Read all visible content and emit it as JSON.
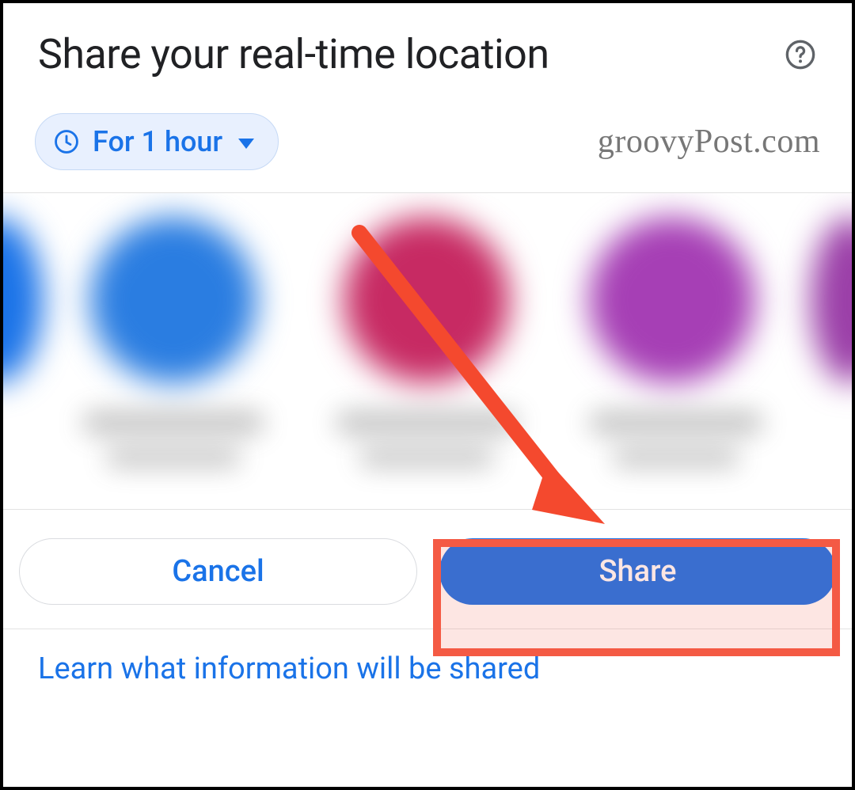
{
  "header": {
    "title": "Share your real-time location"
  },
  "duration_chip": {
    "label": "For 1 hour"
  },
  "watermark": "groovyPost.com",
  "buttons": {
    "cancel": "Cancel",
    "share": "Share"
  },
  "learn_link": "Learn what information will be shared",
  "contact_avatars": [
    {
      "color": "#1a73e8"
    },
    {
      "color": "#2a7de1"
    },
    {
      "color": "#c72a63"
    },
    {
      "color": "#a63fb5"
    },
    {
      "color": "#9b3fa8"
    }
  ],
  "annotation": {
    "arrow_color": "#f4492e",
    "highlight_color": "#f45a44"
  }
}
